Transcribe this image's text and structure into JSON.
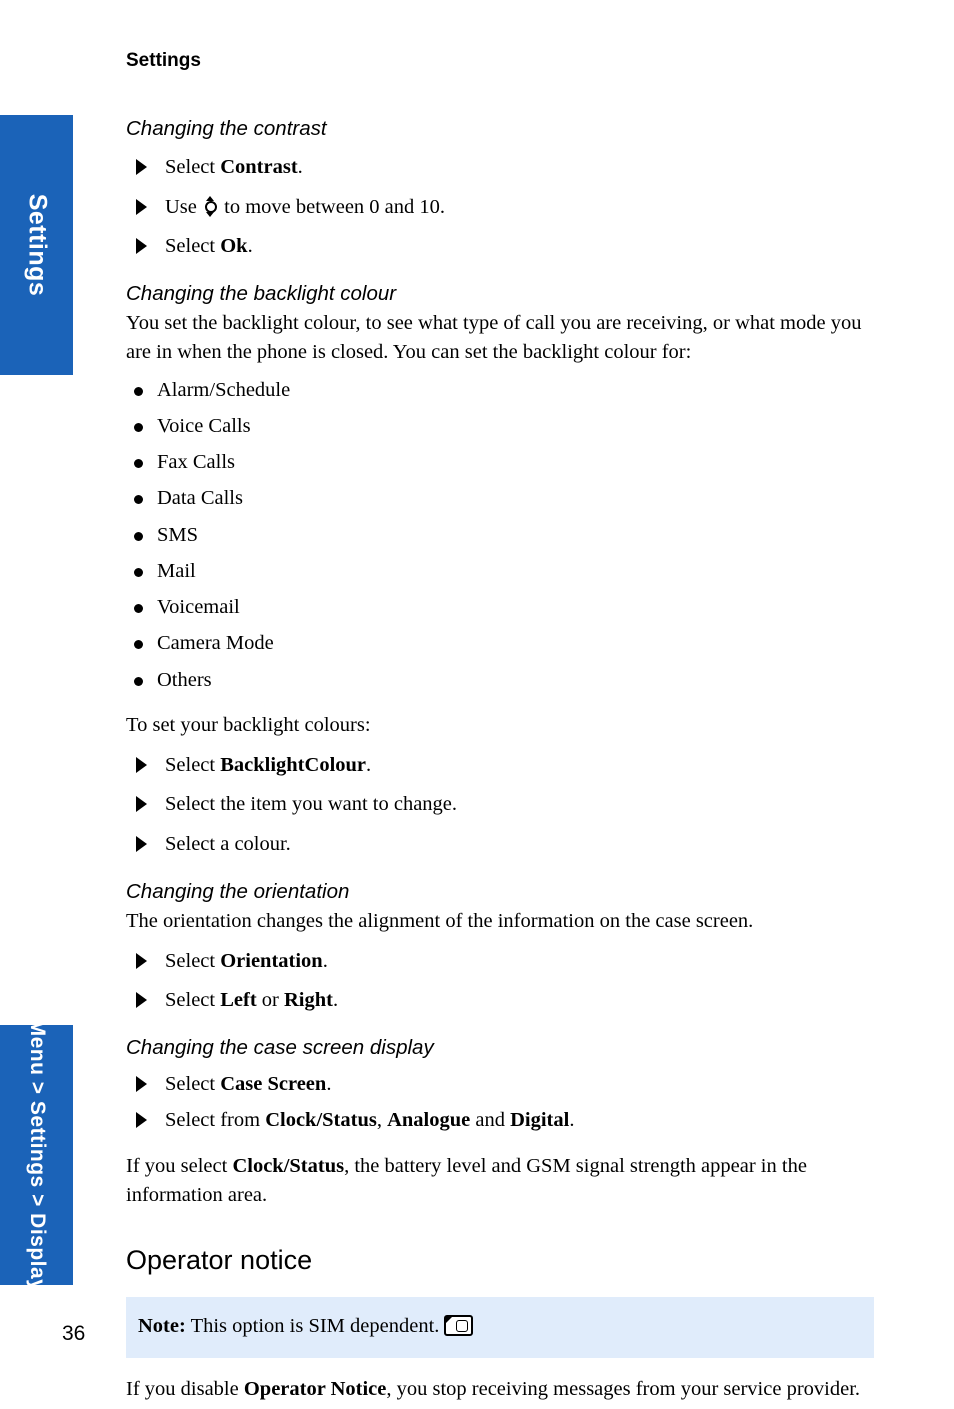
{
  "page": {
    "running_head": "Settings",
    "page_number": "36",
    "accent_color": "#1b63b8",
    "note_background_color": "#e0ecfb"
  },
  "tabs": {
    "top_label": "Settings",
    "bottom_label": "Menu > Settings > Display"
  },
  "sections": {
    "contrast": {
      "heading": "Changing the contrast",
      "steps": [
        {
          "prefix": "Select ",
          "bold": "Contrast",
          "suffix": "."
        },
        {
          "prefix": "Use ",
          "icon": "nav-key-up-down-icon",
          "suffix": " to move between 0 and 10."
        },
        {
          "prefix": "Select ",
          "bold": "Ok",
          "suffix": "."
        }
      ]
    },
    "backlight": {
      "heading": "Changing the backlight colour",
      "intro": "You set the backlight colour, to see what type of call you are receiving, or what mode you are in when the phone is closed. You can set the backlight colour for:",
      "bullets": [
        "Alarm/Schedule",
        "Voice Calls",
        "Fax Calls",
        "Data Calls",
        "SMS",
        "Mail",
        "Voicemail",
        "Camera Mode",
        "Others"
      ],
      "outro": "To set your backlight colours:",
      "steps": [
        {
          "prefix": "Select ",
          "bold": "BacklightColour",
          "suffix": "."
        },
        {
          "prefix": "Select the item you want to change."
        },
        {
          "prefix": "Select a colour."
        }
      ]
    },
    "orientation": {
      "heading": "Changing the orientation",
      "intro": "The orientation changes the alignment of the information on the case screen.",
      "steps": [
        {
          "prefix": "Select ",
          "bold": "Orientation",
          "suffix": "."
        },
        {
          "prefix": "Select ",
          "bold": "Left",
          "mid": " or ",
          "bold2": "Right",
          "suffix": "."
        }
      ]
    },
    "case_screen": {
      "heading": "Changing the case screen display",
      "steps": [
        {
          "prefix": "Select ",
          "bold": "Case Screen",
          "suffix": "."
        },
        {
          "prefix": "Select from ",
          "bold": "Clock/Status",
          "mid": ", ",
          "bold2": "Analogue",
          "mid2": " and ",
          "bold3": "Digital",
          "suffix": "."
        }
      ],
      "outro_pre": "If you select ",
      "outro_bold": "Clock/Status",
      "outro_post": ", the battery level and GSM signal strength appear in the information area."
    },
    "operator_notice": {
      "heading": "Operator notice",
      "note_label": "Note:",
      "note_text": " This option is SIM dependent.",
      "note_icon": "sim-card-icon",
      "body_pre": "If you disable ",
      "body_bold": "Operator Notice",
      "body_post": ", you stop receiving messages from your service provider."
    }
  }
}
